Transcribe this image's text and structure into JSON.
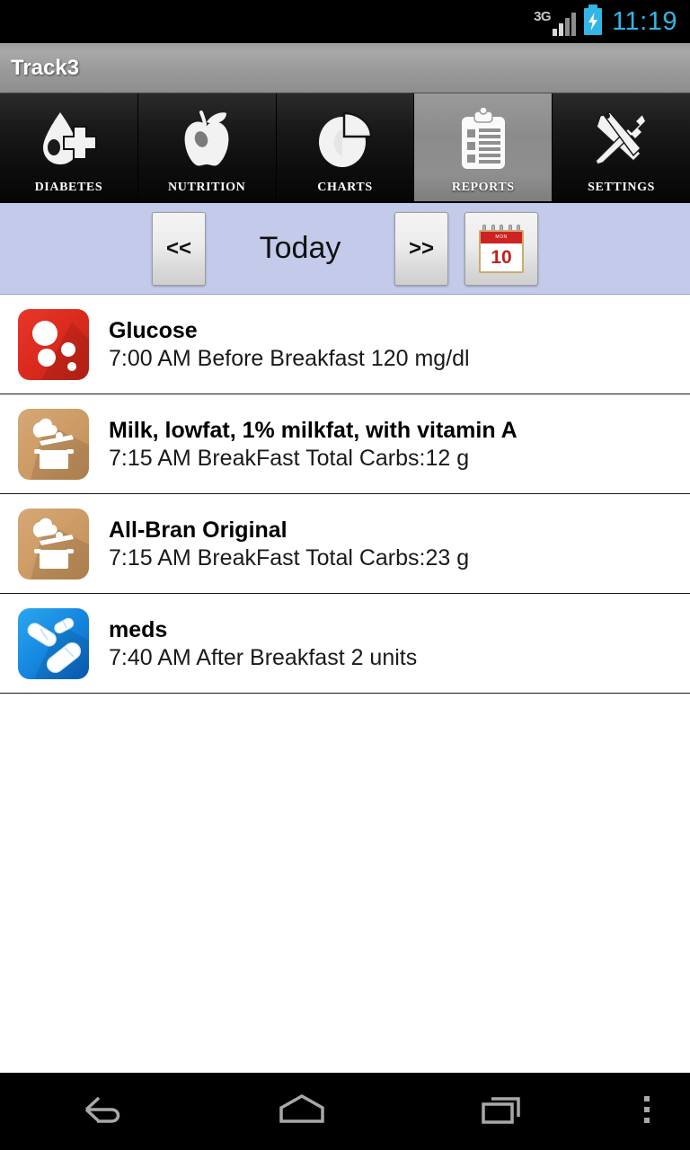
{
  "status_bar": {
    "network": "3G",
    "time": "11:19",
    "signal_icon": "signal-bars-icon",
    "battery_icon": "battery-charging-icon",
    "accent_color": "#33b5e5"
  },
  "title_bar": {
    "app_title": "Track3"
  },
  "tabs": [
    {
      "label": "DIABETES",
      "icon": "blood-drop-cross-icon",
      "selected": false
    },
    {
      "label": "NUTRITION",
      "icon": "apple-icon",
      "selected": false
    },
    {
      "label": "CHARTS",
      "icon": "pie-chart-icon",
      "selected": false
    },
    {
      "label": "REPORTS",
      "icon": "clipboard-icon",
      "selected": true
    },
    {
      "label": "SETTINGS",
      "icon": "tools-wrench-screwdriver-icon",
      "selected": false
    }
  ],
  "date_nav": {
    "prev_label": "<<",
    "next_label": ">>",
    "current_label": "Today",
    "calendar_icon": "calendar-icon",
    "calendar_day": "10",
    "calendar_month": "MON",
    "background_color": "#c3caea"
  },
  "entries": [
    {
      "icon": "glucose-icon",
      "icon_color": "#d8291c",
      "title": "Glucose",
      "detail": "7:00 AM Before Breakfast 120 mg/dl"
    },
    {
      "icon": "food-pot-icon",
      "icon_color": "#cc9a64",
      "title": "Milk, lowfat, 1% milkfat, with vitamin A",
      "detail": "7:15 AM BreakFast Total Carbs:12 g"
    },
    {
      "icon": "food-pot-icon",
      "icon_color": "#cc9a64",
      "title": "All-Bran Original",
      "detail": "7:15 AM BreakFast Total Carbs:23 g"
    },
    {
      "icon": "meds-pills-icon",
      "icon_color": "#1483dd",
      "title": "meds",
      "detail": "7:40 AM After Breakfast 2 units"
    }
  ],
  "system_nav": {
    "back": "back-icon",
    "home": "home-icon",
    "recents": "recents-icon",
    "overflow": "overflow-menu-icon"
  }
}
